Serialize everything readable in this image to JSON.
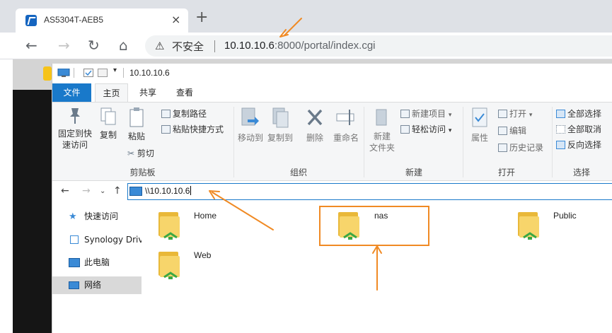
{
  "browser": {
    "tab_title": "AS5304T-AEB5",
    "tab_close": "×",
    "new_tab": "+",
    "insecure_label": "不安全",
    "url_host": "10.10.10.6",
    "url_rest": ":8000/portal/index.cgi"
  },
  "explorer": {
    "window_title": "10.10.10.6",
    "tabs": [
      "文件",
      "主页",
      "共享",
      "查看"
    ],
    "ribbon": {
      "clipboard": {
        "pin_label_1": "固定到快",
        "pin_label_2": "速访问",
        "copy": "复制",
        "paste": "粘贴",
        "copy_path": "复制路径",
        "paste_shortcut": "粘贴快捷方式",
        "cut": "剪切",
        "group": "剪贴板"
      },
      "organize": {
        "move_to": "移动到",
        "copy_to": "复制到",
        "delete": "删除",
        "rename": "重命名",
        "group": "组织"
      },
      "new": {
        "new_folder_1": "新建",
        "new_folder_2": "文件夹",
        "new_item": "新建项目",
        "easy_access": "轻松访问",
        "group": "新建"
      },
      "open": {
        "properties": "属性",
        "open": "打开",
        "edit": "编辑",
        "history": "历史记录",
        "group": "打开"
      },
      "select": {
        "select_all": "全部选择",
        "select_none": "全部取消",
        "invert": "反向选择",
        "group": "选择"
      }
    },
    "address": "\\\\10.10.10.6",
    "nav": [
      "快速访问",
      "Synology Drive",
      "此电脑",
      "网络"
    ],
    "folders": [
      "Home",
      "nas",
      "Public",
      "Web"
    ]
  },
  "colors": {
    "accent": "#1979ca",
    "annotation": "#f08a24"
  }
}
